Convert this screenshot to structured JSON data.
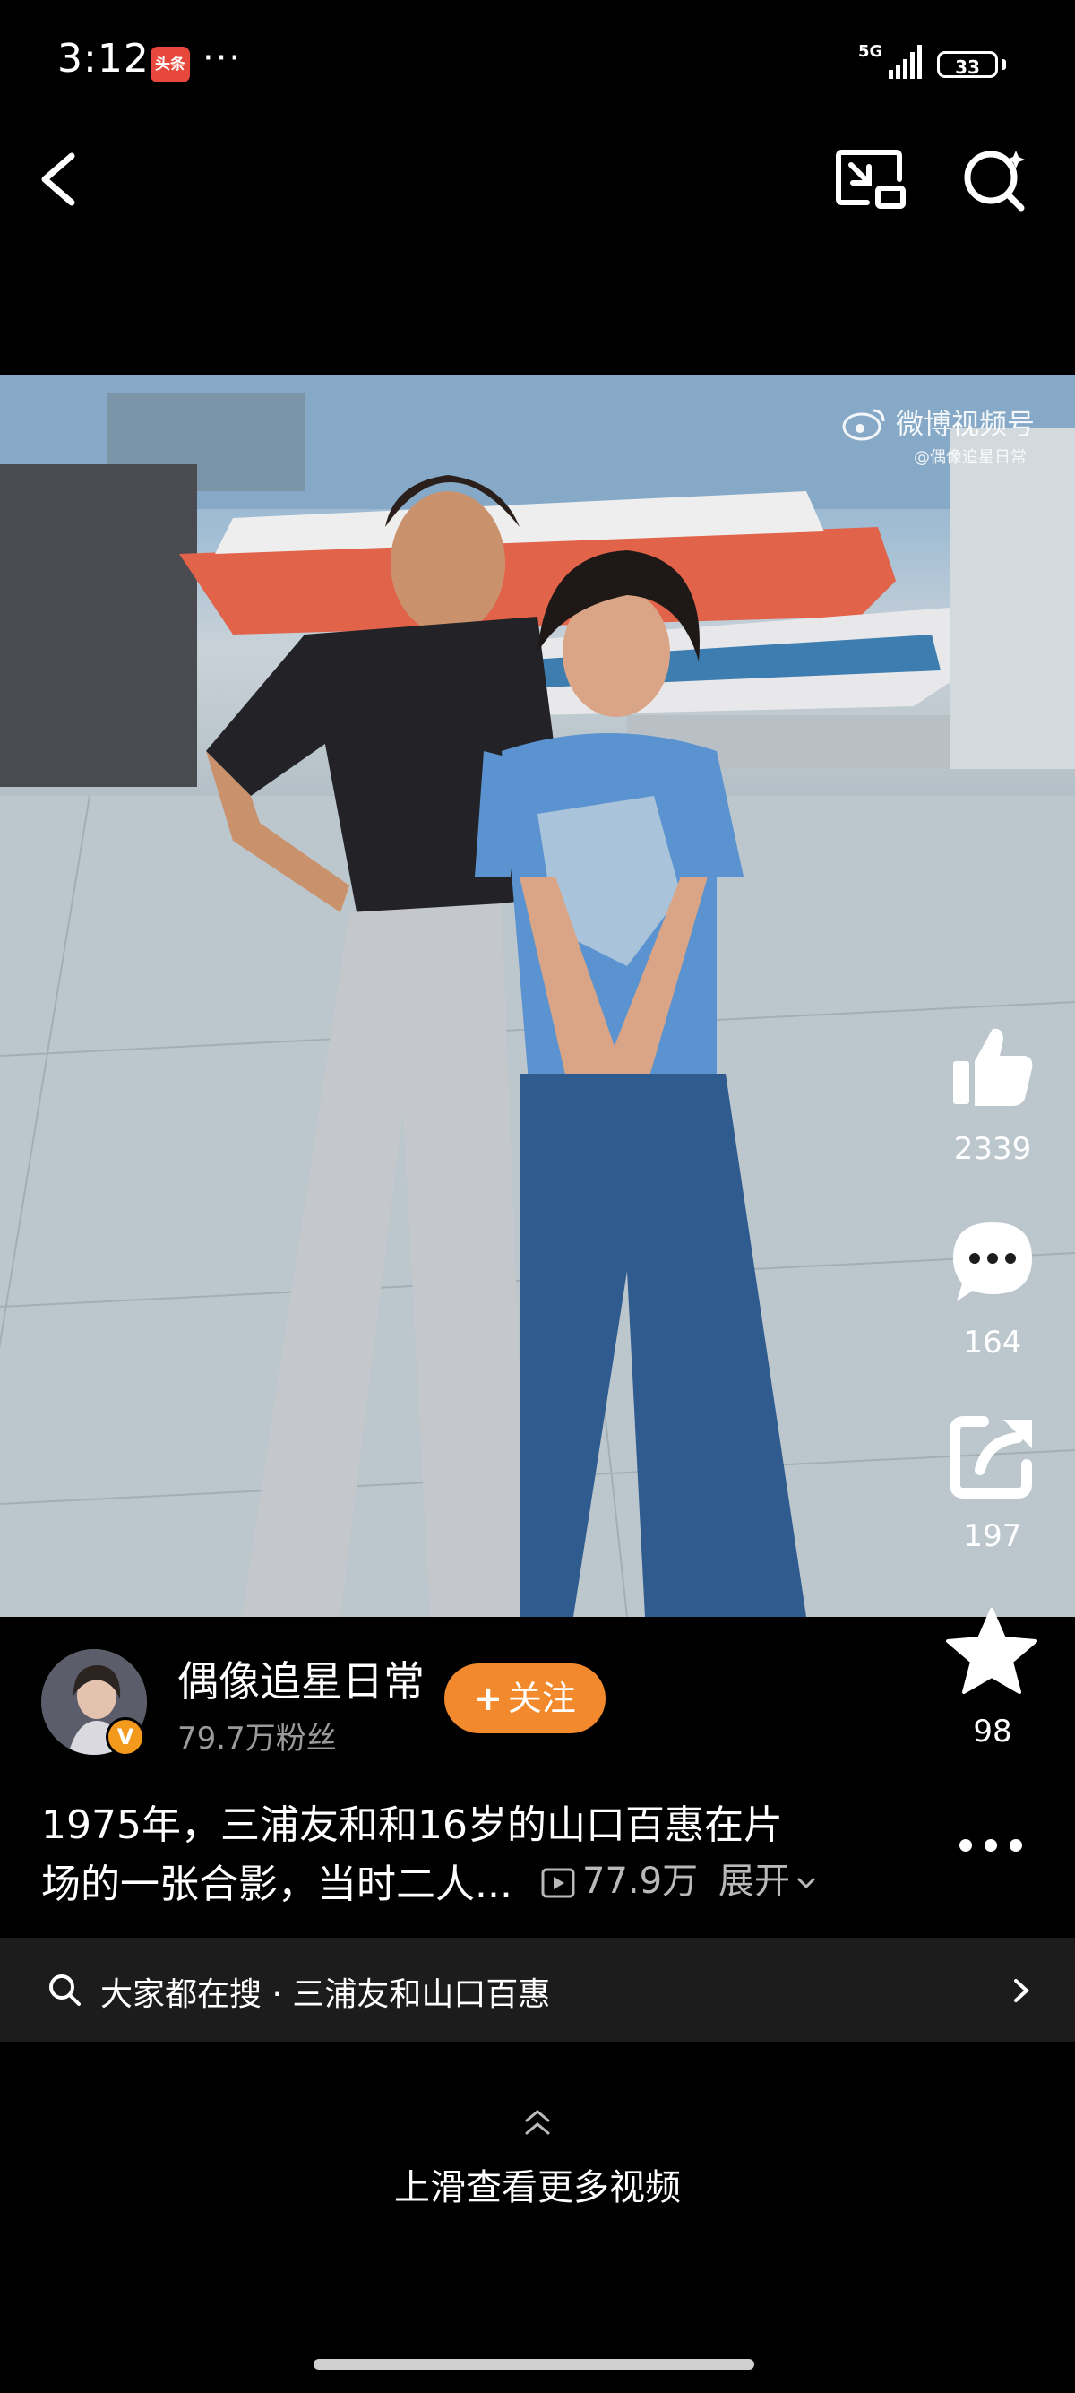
{
  "status_bar": {
    "time": "3:12",
    "app_badge": "头条",
    "more": "···",
    "network": "5G",
    "battery": "33"
  },
  "video": {
    "watermark_main": "微博视频号",
    "watermark_sub": "@偶像追星日常"
  },
  "actions": {
    "likes": "2339",
    "comments": "164",
    "shares": "197",
    "favorites": "98"
  },
  "author": {
    "name": "偶像追星日常",
    "followers": "79.7万粉丝",
    "follow_label": "关注",
    "follow_plus": "+",
    "verified_mark": "V"
  },
  "caption": {
    "line1": "1975年，三浦友和和16岁的山口百惠在片",
    "line2": "场的一张合影，当时二人...",
    "views": "77.9万",
    "expand": "展开"
  },
  "search": {
    "text": "大家都在搜 · 三浦友和山口百惠"
  },
  "swipe_hint": "上滑查看更多视频"
}
